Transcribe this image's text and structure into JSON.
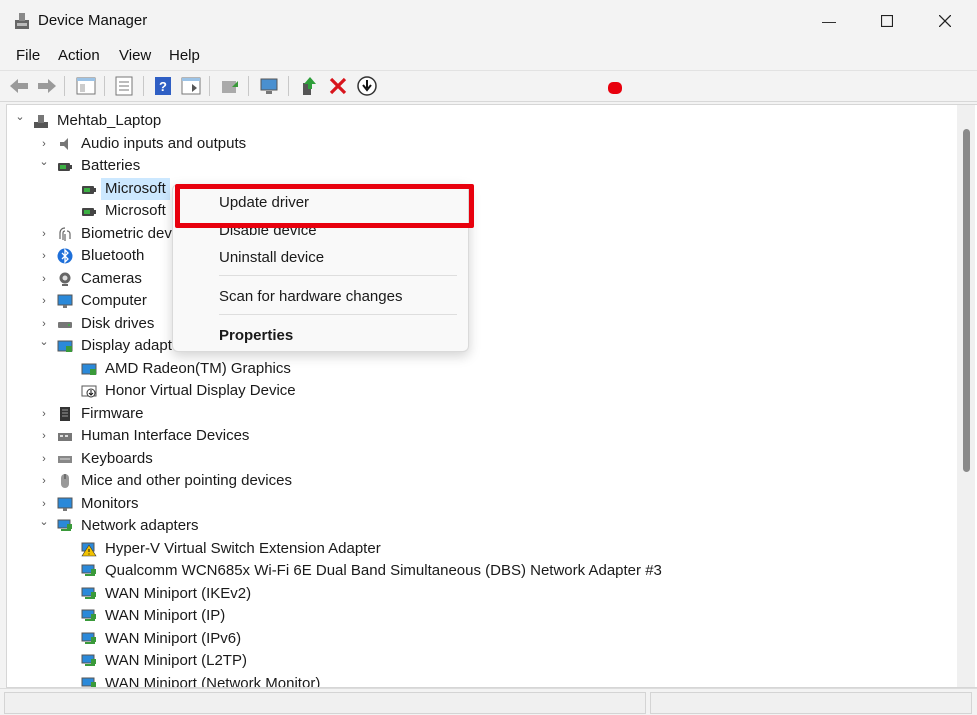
{
  "window": {
    "title": "Device Manager"
  },
  "menu": [
    "File",
    "Action",
    "View",
    "Help"
  ],
  "toolbar": [
    "back-icon",
    "forward-icon",
    "properties-pane-icon",
    "list-view-icon",
    "help-icon",
    "action-view-icon",
    "update-driver-icon",
    "scan-hardware-icon",
    "enable-device-icon",
    "uninstall-device-icon",
    "download-icon"
  ],
  "tree": [
    {
      "label": "Mehtab_Laptop",
      "level": 0,
      "state": "expanded",
      "icon": "computer-icon"
    },
    {
      "label": "Audio inputs and outputs",
      "level": 1,
      "state": "collapsed",
      "icon": "speaker-icon"
    },
    {
      "label": "Batteries",
      "level": 1,
      "state": "expanded",
      "icon": "battery-icon"
    },
    {
      "label": "Microsoft",
      "level": 2,
      "state": "leaf",
      "icon": "battery-icon",
      "selected": true
    },
    {
      "label": "Microsoft",
      "level": 2,
      "state": "leaf",
      "icon": "battery-icon"
    },
    {
      "label": "Biometric dev",
      "level": 1,
      "state": "collapsed",
      "icon": "fingerprint-icon"
    },
    {
      "label": "Bluetooth",
      "level": 1,
      "state": "collapsed",
      "icon": "bluetooth-icon"
    },
    {
      "label": "Cameras",
      "level": 1,
      "state": "collapsed",
      "icon": "camera-icon"
    },
    {
      "label": "Computer",
      "level": 1,
      "state": "collapsed",
      "icon": "monitor-icon"
    },
    {
      "label": "Disk drives",
      "level": 1,
      "state": "collapsed",
      "icon": "disk-icon"
    },
    {
      "label": "Display adapt",
      "level": 1,
      "state": "expanded",
      "icon": "display-adapter-icon"
    },
    {
      "label": "AMD Radeon(TM) Graphics",
      "level": 2,
      "state": "leaf",
      "icon": "display-adapter-icon"
    },
    {
      "label": "Honor Virtual Display Device",
      "level": 2,
      "state": "leaf",
      "icon": "virtual-display-icon"
    },
    {
      "label": "Firmware",
      "level": 1,
      "state": "collapsed",
      "icon": "firmware-icon"
    },
    {
      "label": "Human Interface Devices",
      "level": 1,
      "state": "collapsed",
      "icon": "hid-icon"
    },
    {
      "label": "Keyboards",
      "level": 1,
      "state": "collapsed",
      "icon": "keyboard-icon"
    },
    {
      "label": "Mice and other pointing devices",
      "level": 1,
      "state": "collapsed",
      "icon": "mouse-icon"
    },
    {
      "label": "Monitors",
      "level": 1,
      "state": "collapsed",
      "icon": "monitor-icon"
    },
    {
      "label": "Network adapters",
      "level": 1,
      "state": "expanded",
      "icon": "network-icon"
    },
    {
      "label": "Hyper-V Virtual Switch Extension Adapter",
      "level": 2,
      "state": "leaf",
      "icon": "network-warning-icon"
    },
    {
      "label": "Qualcomm WCN685x Wi-Fi 6E Dual Band Simultaneous (DBS) Network Adapter #3",
      "level": 2,
      "state": "leaf",
      "icon": "network-icon"
    },
    {
      "label": "WAN Miniport (IKEv2)",
      "level": 2,
      "state": "leaf",
      "icon": "network-icon"
    },
    {
      "label": "WAN Miniport (IP)",
      "level": 2,
      "state": "leaf",
      "icon": "network-icon"
    },
    {
      "label": "WAN Miniport (IPv6)",
      "level": 2,
      "state": "leaf",
      "icon": "network-icon"
    },
    {
      "label": "WAN Miniport (L2TP)",
      "level": 2,
      "state": "leaf",
      "icon": "network-icon"
    },
    {
      "label": "WAN Miniport (Network Monitor)",
      "level": 2,
      "state": "leaf",
      "icon": "network-icon"
    }
  ],
  "context_menu": {
    "update": "Update driver",
    "disable": "Disable device",
    "uninstall": "Uninstall device",
    "scan": "Scan for hardware changes",
    "properties": "Properties"
  },
  "colors": {
    "highlight": "#e8000d",
    "selection": "#cce8ff"
  }
}
